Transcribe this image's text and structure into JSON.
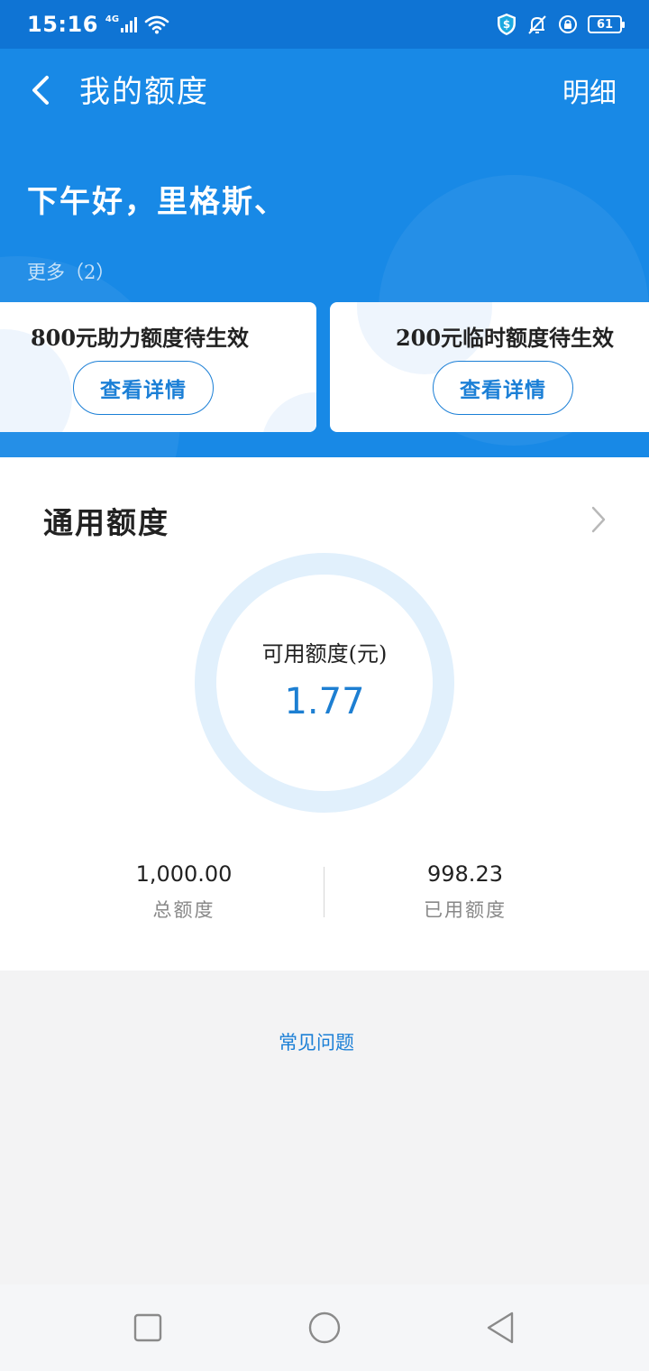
{
  "status_bar": {
    "time": "15:16",
    "network": "4G",
    "battery": "61"
  },
  "nav": {
    "title": "我的额度",
    "detail_label": "明细"
  },
  "greeting": "下午好，里格斯、",
  "more_link": "更多（2）",
  "promo_cards": [
    {
      "title": "800元助力额度待生效",
      "button_label": "查看详情"
    },
    {
      "title": "200元临时额度待生效",
      "button_label": "查看详情"
    }
  ],
  "credit": {
    "section_title": "通用额度",
    "available_label": "可用额度(元)",
    "available_value": "1.77",
    "total_value": "1,000.00",
    "total_label": "总额度",
    "used_value": "998.23",
    "used_label": "已用额度"
  },
  "faq_label": "常见问题",
  "colors": {
    "header_blue": "#1889e6",
    "status_blue": "#0f74d4",
    "accent_blue": "#1b7fd6",
    "ring_light": "#e1f0fc"
  },
  "icons": {
    "back": "back-arrow-icon",
    "chevron": "chevron-right-icon",
    "nav_recent": "square-icon",
    "nav_home": "circle-icon",
    "nav_back": "triangle-back-icon"
  }
}
